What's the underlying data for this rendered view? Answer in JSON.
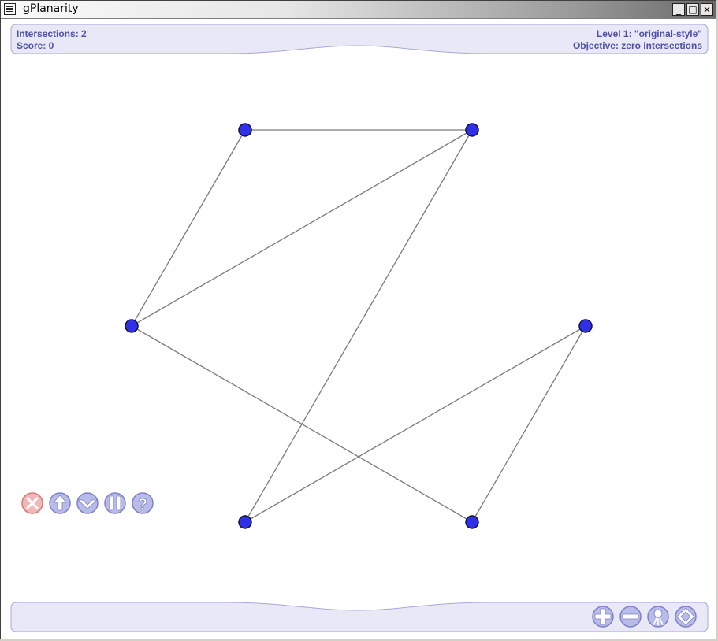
{
  "window": {
    "title": "gPlanarity",
    "minimize_glyph": "_",
    "maximize_glyph": "□",
    "close_glyph": "×"
  },
  "hud": {
    "intersections": "Intersections: 2",
    "score": "Score: 0",
    "level": "Level 1: \"original-style\"",
    "objective": "Objective: zero intersections"
  },
  "graph": {
    "vertex_color": "#3030e8",
    "edge_color": "#7a7a7a",
    "vertices": [
      "v1",
      "v2",
      "v3",
      "v4",
      "v5",
      "v6"
    ],
    "edges": [
      [
        "v1",
        "v2"
      ],
      [
        "v1",
        "v3"
      ],
      [
        "v2",
        "v3"
      ],
      [
        "v2",
        "v5"
      ],
      [
        "v3",
        "v6"
      ],
      [
        "v4",
        "v5"
      ],
      [
        "v4",
        "v6"
      ]
    ]
  },
  "controls": {
    "left": [
      {
        "name": "quit-button",
        "icon": "x-icon"
      },
      {
        "name": "expand-button",
        "icon": "arrow-up-icon"
      },
      {
        "name": "reset-button",
        "icon": "down-chevron-icon"
      },
      {
        "name": "pause-button",
        "icon": "pause-icon"
      },
      {
        "name": "help-button",
        "icon": "question-icon"
      }
    ],
    "right": [
      {
        "name": "zoom-in-button",
        "icon": "plus-icon"
      },
      {
        "name": "zoom-out-button",
        "icon": "minus-icon"
      },
      {
        "name": "hide-lines-button",
        "icon": "lamp-icon"
      },
      {
        "name": "fullscreen-button",
        "icon": "diamond-icon"
      }
    ]
  },
  "colors": {
    "panel_fill": "#e8e8f6",
    "panel_border": "#a8a8d8",
    "button_fill": "#b8bce8",
    "button_border": "#8080c8",
    "quit_fill": "#f0b8b8",
    "quit_border": "#d87878"
  }
}
